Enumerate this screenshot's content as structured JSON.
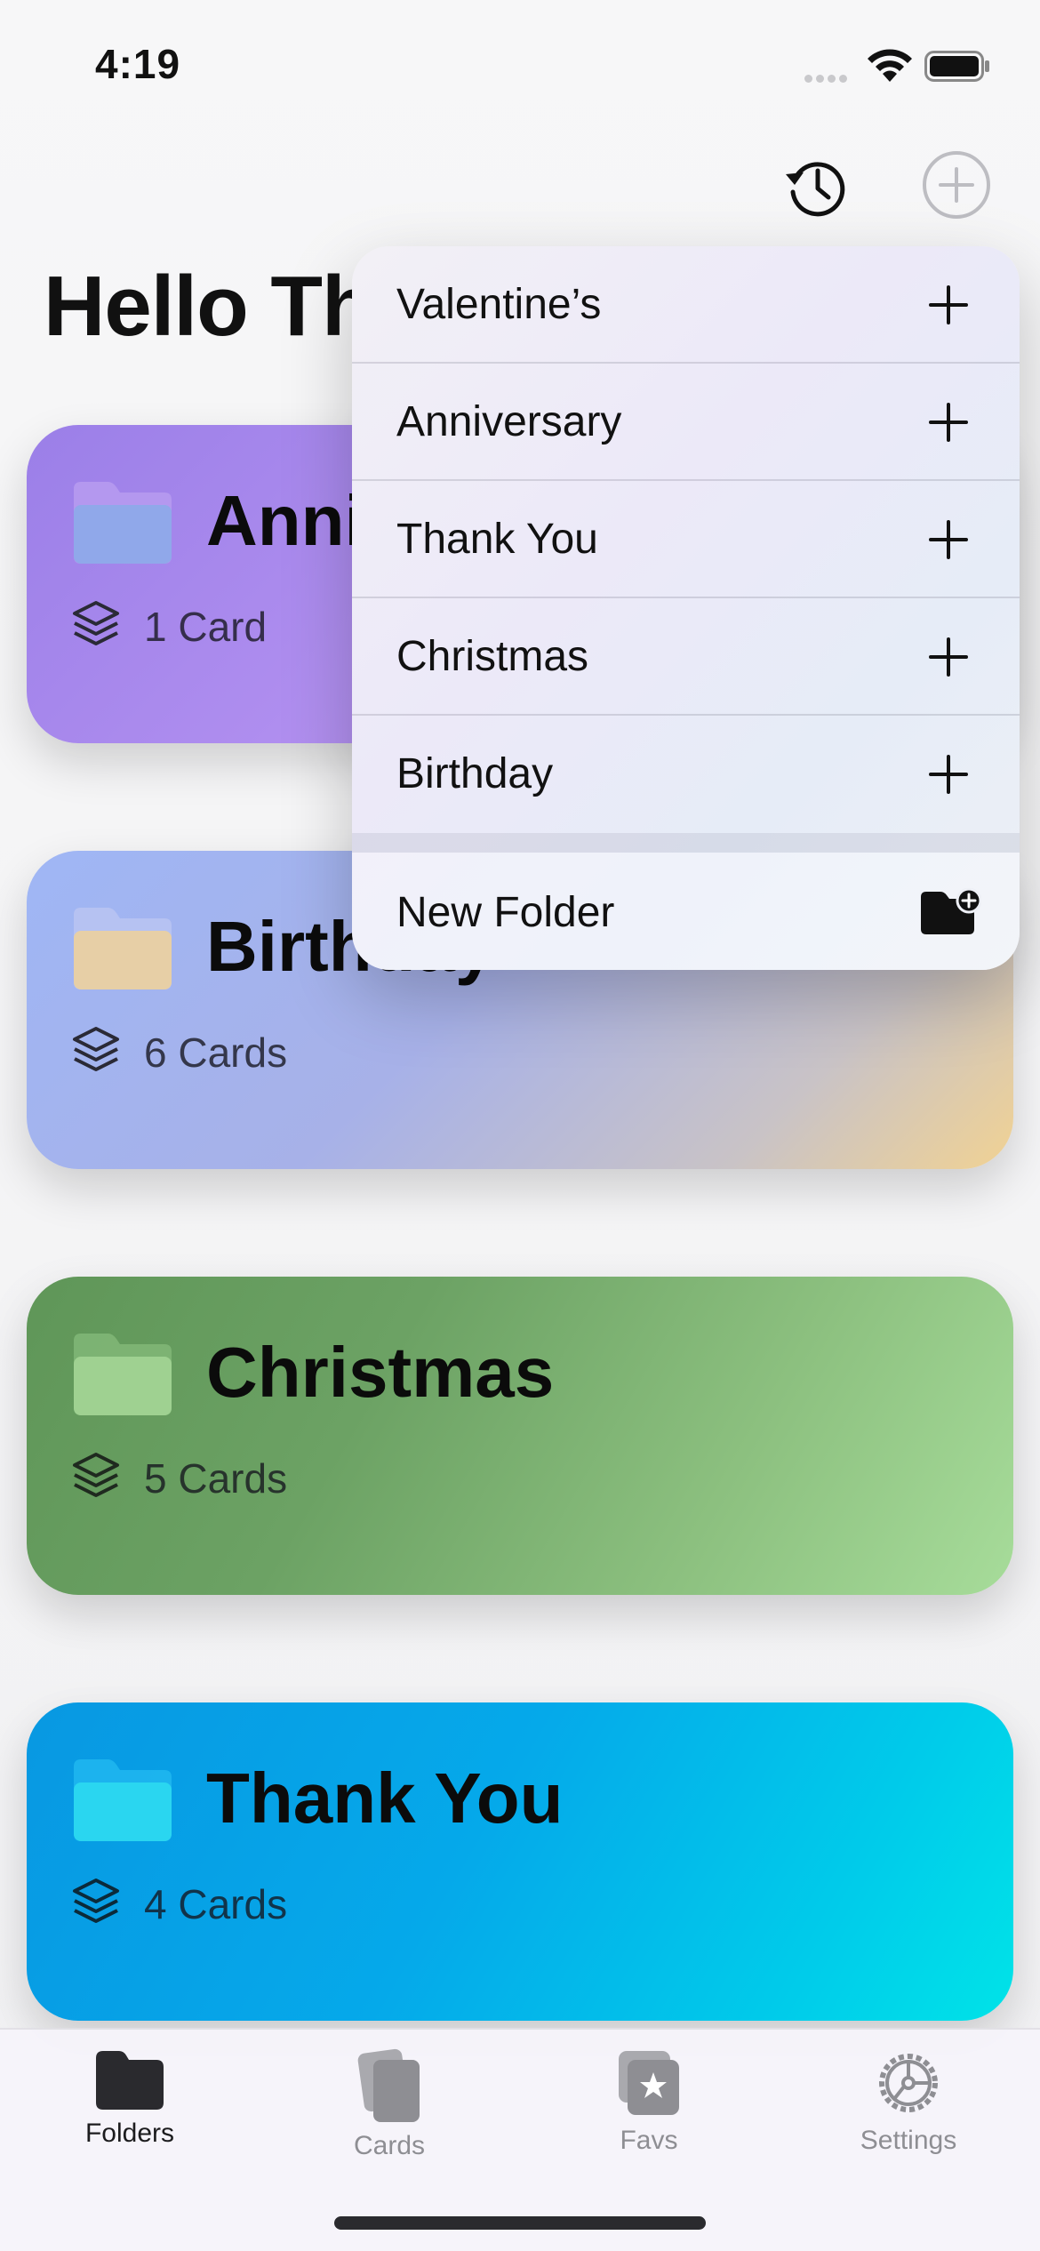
{
  "status_bar": {
    "time": "4:19"
  },
  "header": {
    "title": "Hello There"
  },
  "folders": [
    {
      "title": "Anniversary",
      "count": "1 Card"
    },
    {
      "title": "Birthday",
      "count": "6 Cards"
    },
    {
      "title": "Christmas",
      "count": "5 Cards"
    },
    {
      "title": "Thank You",
      "count": "4 Cards"
    }
  ],
  "menu": {
    "items": [
      "Valentine’s",
      "Anniversary",
      "Thank You",
      "Christmas",
      "Birthday"
    ],
    "new_folder": "New Folder"
  },
  "tabbar": {
    "tabs": [
      {
        "label": "Folders",
        "active": true
      },
      {
        "label": "Cards",
        "active": false
      },
      {
        "label": "Favs",
        "active": false
      },
      {
        "label": "Settings",
        "active": false
      }
    ]
  },
  "icons": {
    "history": "history-icon",
    "add": "plus-circle-icon",
    "folder": "folder-icon",
    "stack": "stack-icon",
    "menu_add": "plus-icon",
    "new_folder": "folder-badge-plus-icon",
    "tab_folders": "folder-fill-icon",
    "tab_cards": "cards-icon",
    "tab_favs": "star-cards-icon",
    "tab_settings": "gear-icon"
  },
  "colors": {
    "anniversary": "#a988ee",
    "birthday": "#a7b5ee",
    "christmas": "#6ea466",
    "thank_you": "#06b0ea"
  }
}
